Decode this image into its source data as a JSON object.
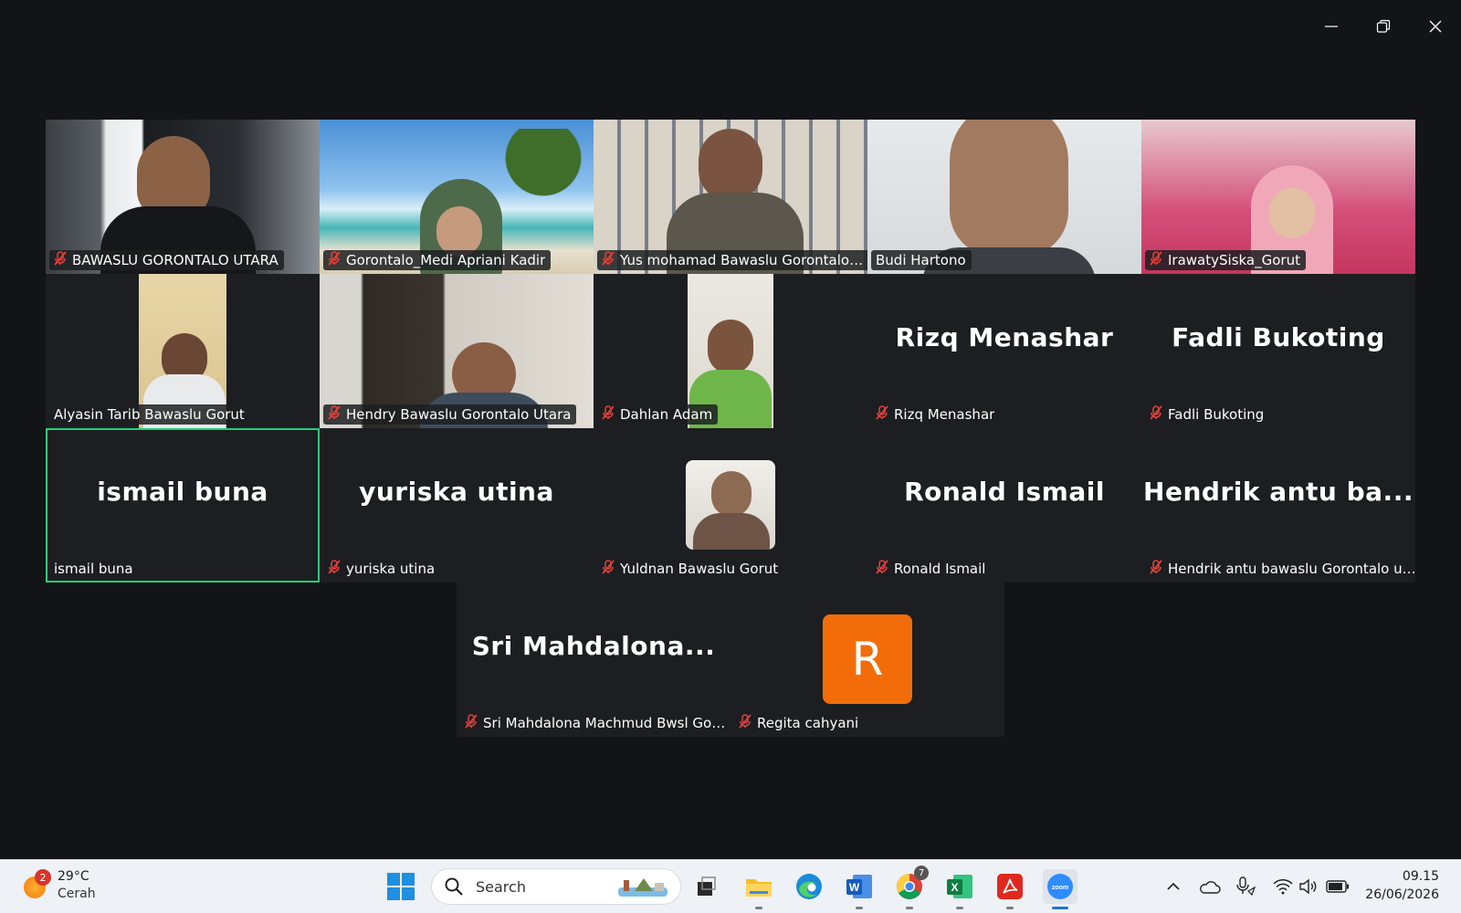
{
  "participants": [
    {
      "name": "BAWASLU GORONTALO UTARA",
      "muted": true
    },
    {
      "name": "Gorontalo_Medi Apriani Kadir",
      "muted": true
    },
    {
      "name": "Yus mohamad Bawaslu Gorontalo ut...",
      "muted": true
    },
    {
      "name": "Budi Hartono",
      "muted": false
    },
    {
      "name": "IrawatySiska_Gorut",
      "muted": true
    },
    {
      "name": "Alyasin Tarib Bawaslu Gorut",
      "muted": false
    },
    {
      "name": "Hendry Bawaslu Gorontalo Utara",
      "muted": true
    },
    {
      "name": "Dahlan Adam",
      "muted": true
    },
    {
      "name": "Rizq Menashar",
      "display": "Rizq Menashar",
      "muted": true
    },
    {
      "name": "Fadli Bukoting",
      "display": "Fadli Bukoting",
      "muted": true
    },
    {
      "name": "ismail buna",
      "display": "ismail buna",
      "muted": false
    },
    {
      "name": "yuriska utina",
      "display": "yuriska utina",
      "muted": true
    },
    {
      "name": "Yuldnan Bawaslu Gorut",
      "muted": true
    },
    {
      "name": "Ronald Ismail",
      "display": "Ronald Ismail",
      "muted": true
    },
    {
      "name": "Hendrik antu bawaslu Gorontalo utara",
      "display": "Hendrik antu ba...",
      "muted": true
    },
    {
      "name": "Sri Mahdalona Machmud Bwsl Gorut",
      "display": "Sri  Mahdalona...",
      "muted": true
    },
    {
      "name": "Regita cahyani",
      "initial": "R",
      "avatar_color": "#f26d0a",
      "muted": true
    }
  ],
  "active_speaker_color": "#1fd17a",
  "taskbar": {
    "weather": {
      "temp": "29°C",
      "condition": "Cerah",
      "badge": "2"
    },
    "search_placeholder": "Search",
    "apps": [
      "windows-start",
      "search",
      "task-view",
      "file-explorer",
      "edge",
      "word",
      "chrome",
      "excel",
      "acrobat",
      "zoom"
    ],
    "chrome_badge": "7",
    "clock": {
      "time": "09.15",
      "date": "26/06/2026"
    }
  }
}
